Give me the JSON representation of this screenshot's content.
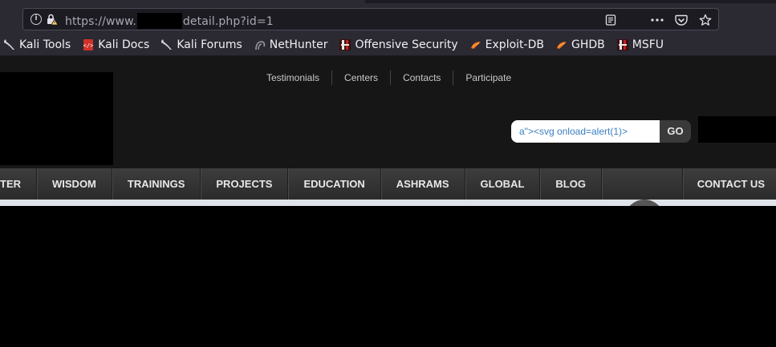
{
  "browser": {
    "url": {
      "prefix": "https://www.",
      "suffix": "detail.php?id=1"
    },
    "bookmarks": [
      {
        "label": "Kali Tools",
        "icon": "kali-dragon-icon"
      },
      {
        "label": "Kali Docs",
        "icon": "kali-docs-icon"
      },
      {
        "label": "Kali Forums",
        "icon": "kali-dragon-icon"
      },
      {
        "label": "NetHunter",
        "icon": "nethunter-icon"
      },
      {
        "label": "Offensive Security",
        "icon": "offsec-icon"
      },
      {
        "label": "Exploit-DB",
        "icon": "exploit-db-icon"
      },
      {
        "label": "GHDB",
        "icon": "exploit-db-icon"
      },
      {
        "label": "MSFU",
        "icon": "offsec-icon"
      }
    ]
  },
  "site": {
    "topnav": [
      "Testimonials",
      "Centers",
      "Contacts",
      "Participate"
    ],
    "search": {
      "value": "a\"><svg onload=alert(1)>",
      "button_label": "GO"
    },
    "mainnav": [
      "TER",
      "WISDOM",
      "TRAININGS",
      "PROJECTS",
      "EDUCATION",
      "ASHRAMS",
      "GLOBAL",
      "BLOG"
    ],
    "contact_label": "CONTACT US"
  },
  "colors": {
    "chrome_bg": "#2b2a33",
    "urlbar_bg": "#1c1b22",
    "site_header_bg": "#161616",
    "search_text": "#3a7fc1"
  }
}
